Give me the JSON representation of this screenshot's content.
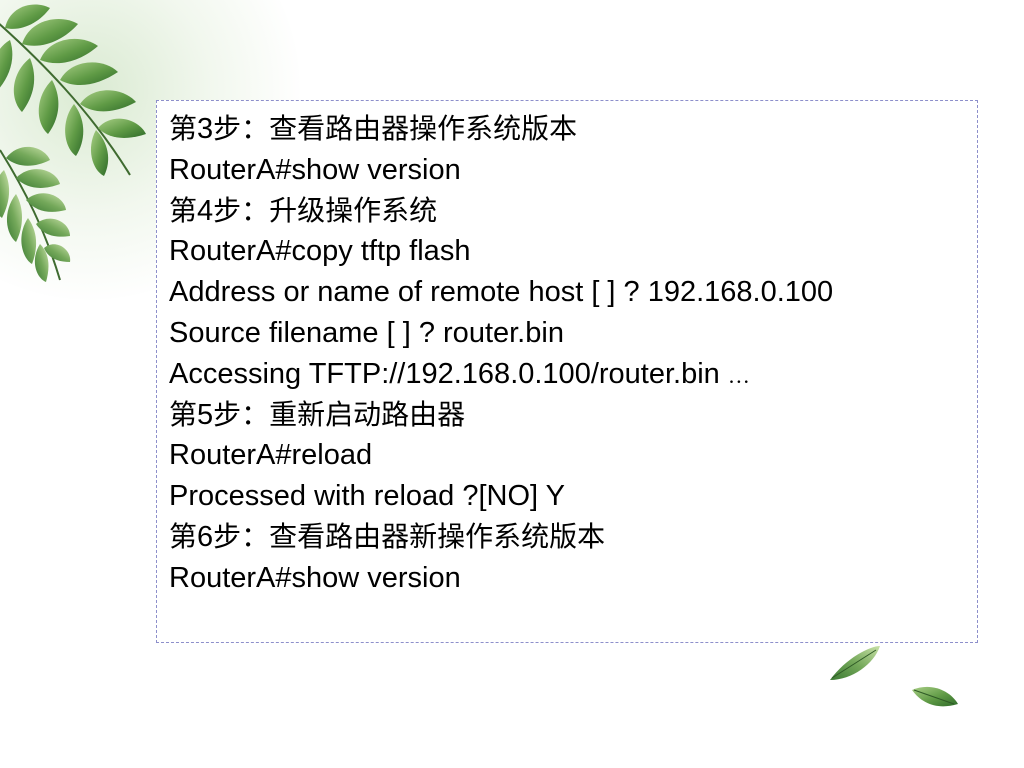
{
  "slide": {
    "lines": [
      {
        "kind": "step",
        "prefix": "第",
        "num": "3",
        "text": "步：查看路由器操作系统版本"
      },
      {
        "kind": "cmd",
        "text": "RouterA#show version"
      },
      {
        "kind": "step",
        "prefix": "第",
        "num": "4",
        "text": "步：升级操作系统"
      },
      {
        "kind": "cmd",
        "text": "RouterA#copy tftp flash"
      },
      {
        "kind": "cmd",
        "text": "Address or name of remote host [ ] ? 192.168.0.100"
      },
      {
        "kind": "cmd",
        "text": "Source filename [ ] ? router.bin"
      },
      {
        "kind": "cmd",
        "text": "Accessing TFTP://192.168.0.100/router.bin ",
        "suffix": "…"
      },
      {
        "kind": "step",
        "prefix": "第",
        "num": "5",
        "text": "步：重新启动路由器"
      },
      {
        "kind": "cmd",
        "text": "RouterA#reload"
      },
      {
        "kind": "cmd",
        "text": "Processed with reload ?[NO] Y"
      },
      {
        "kind": "step",
        "prefix": "第",
        "num": "6",
        "text": "步：查看路由器新操作系统版本"
      },
      {
        "kind": "cmd",
        "text": "RouterA#show version"
      }
    ]
  },
  "colors": {
    "text": "#000000",
    "box_border": "#8d8fcb",
    "leaf_dark": "#2f6b2a",
    "leaf_mid": "#5f9a45",
    "leaf_light": "#a9cf86",
    "background_glow": "#dcebd3"
  },
  "decorations": [
    "fern-leaves-icon",
    "falling-leaf-icon"
  ]
}
